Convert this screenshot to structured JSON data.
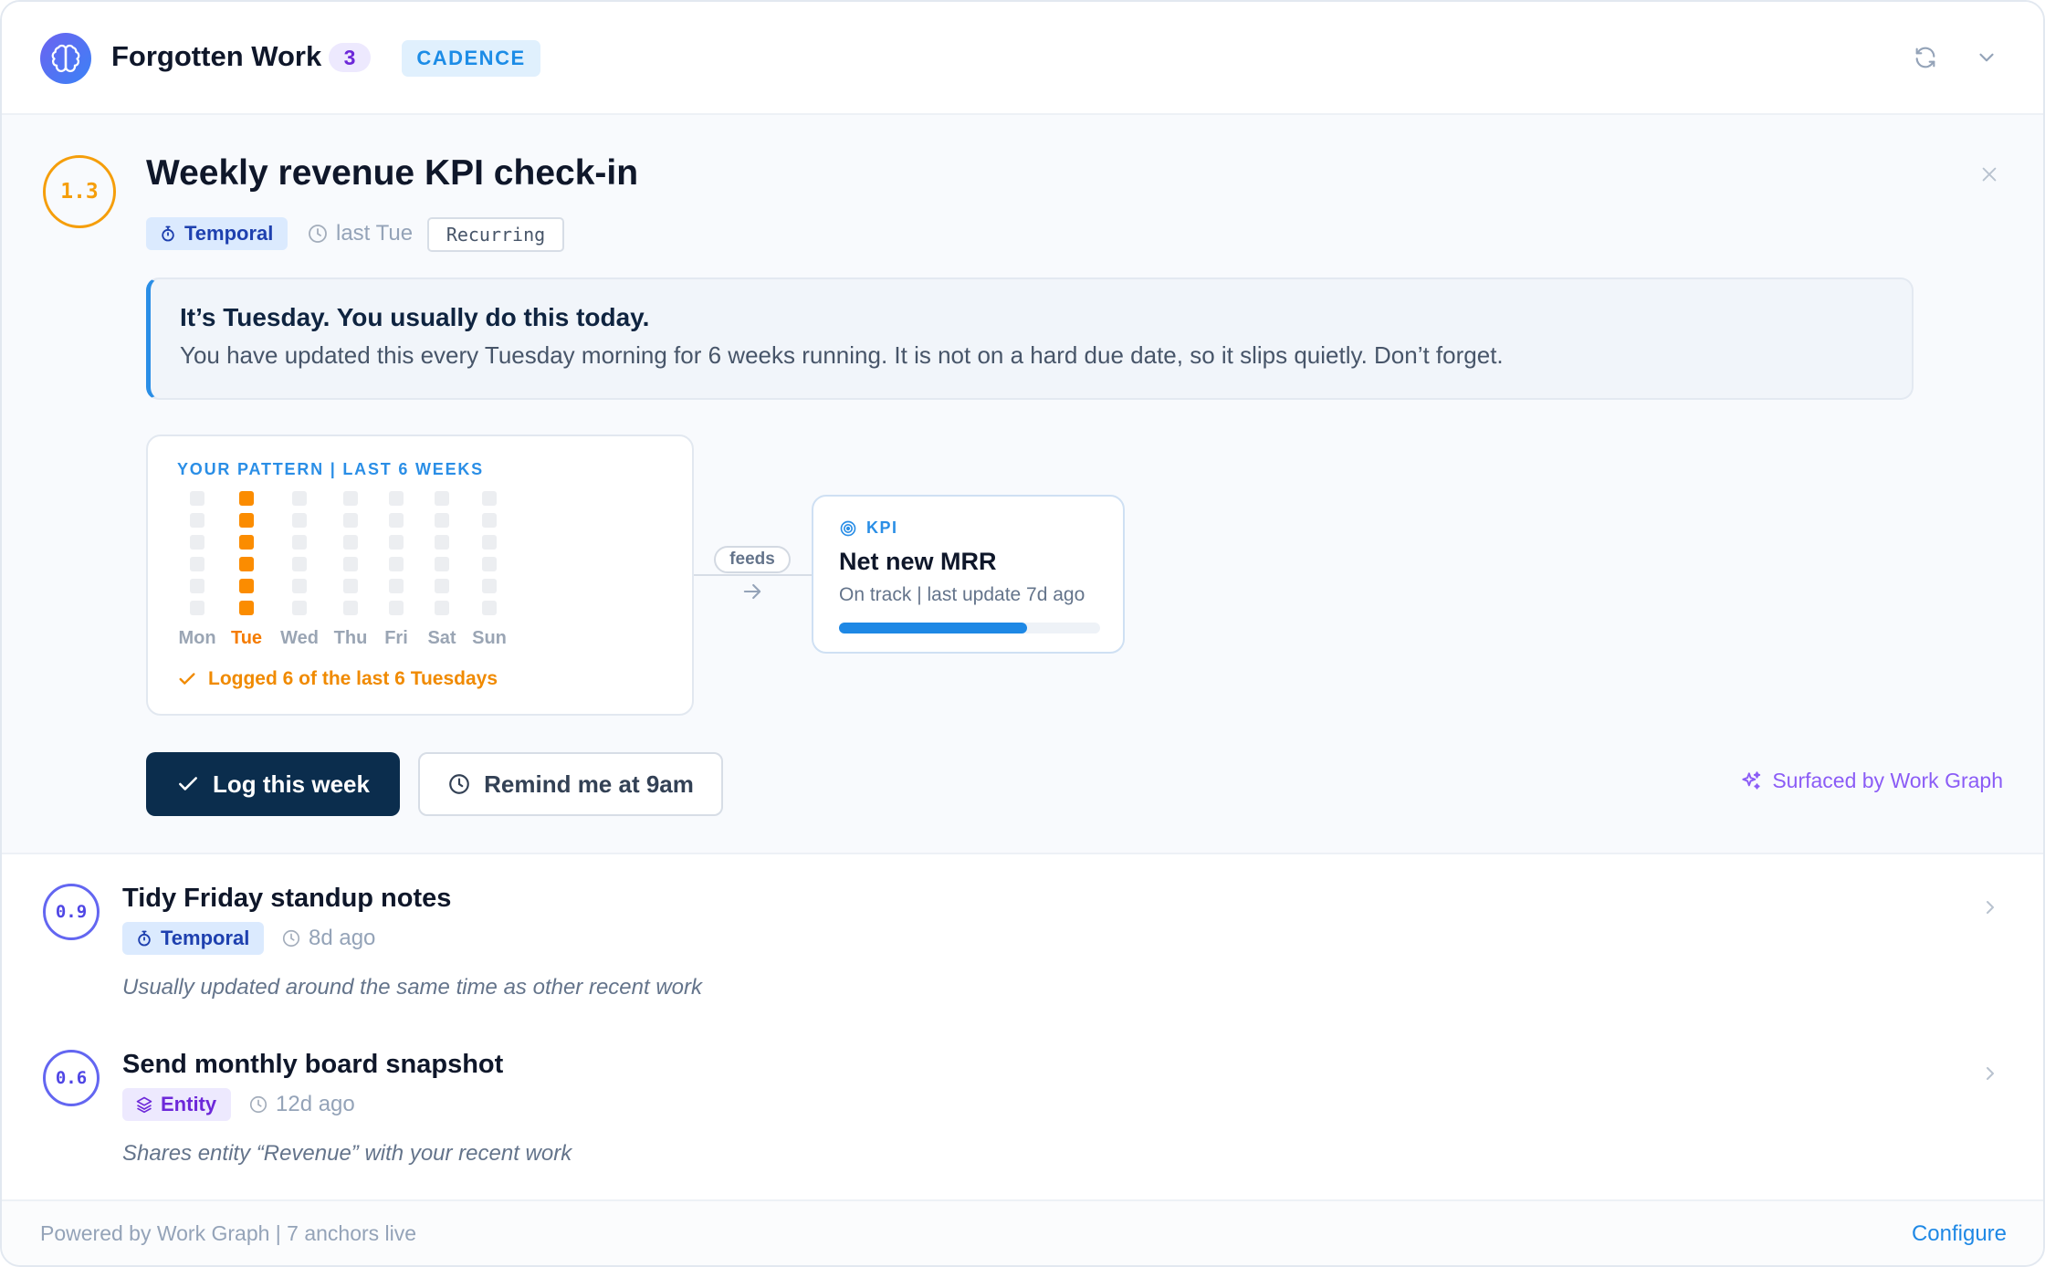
{
  "header": {
    "logo_icon": "brain-icon",
    "title": "Forgotten Work",
    "count": "3",
    "tag": "CADENCE",
    "refresh_icon": "refresh-icon",
    "collapse_icon": "chevron-down-icon"
  },
  "featured": {
    "score": "1.3",
    "title": "Weekly revenue KPI check-in",
    "type_tag": "Temporal",
    "time": "last Tue",
    "recurring": "Recurring",
    "callout": {
      "title": "It’s Tuesday. You usually do this today.",
      "body": "You have updated this every Tuesday morning for 6 weeks running. It is not on a hard due date, so it slips quietly. Don’t forget."
    },
    "pattern": {
      "title": "YOUR PATTERN | LAST 6 WEEKS",
      "days": [
        "Mon",
        "Tue",
        "Wed",
        "Thu",
        "Fri",
        "Sat",
        "Sun"
      ],
      "active_day_index": 1,
      "weeks": 6,
      "logged": [
        0,
        6,
        0,
        0,
        0,
        0,
        0
      ],
      "summary": "Logged 6 of the last 6 Tuesdays"
    },
    "connector": "feeds",
    "kpi": {
      "type": "KPI",
      "name": "Net new MRR",
      "status": "On track | last update 7d ago",
      "progress": 0.72,
      "accent": "#1e88e5"
    },
    "primary_button": "Log this week",
    "secondary_button": "Remind me at 9am",
    "surfaced": "Surfaced by Work Graph"
  },
  "rows": [
    {
      "score": "0.9",
      "title": "Tidy Friday standup notes",
      "tag": "Temporal",
      "time": "8d ago",
      "desc": "Usually updated around the same time as other recent work"
    },
    {
      "score": "0.6",
      "title": "Send monthly board snapshot",
      "tag": "Entity",
      "time": "12d ago",
      "desc": "Shares entity “Revenue” with your recent work"
    }
  ],
  "footer": {
    "text": "Powered by Work Graph | 7 anchors live",
    "link": "Configure"
  },
  "colors": {
    "amber": "#f59e0b",
    "pattern_on": "#fb8c00",
    "indigo": "#6366f1",
    "primary_button": "#0b2d4d",
    "accent_blue": "#2a8ee6",
    "violet": "#8b5cf6"
  }
}
